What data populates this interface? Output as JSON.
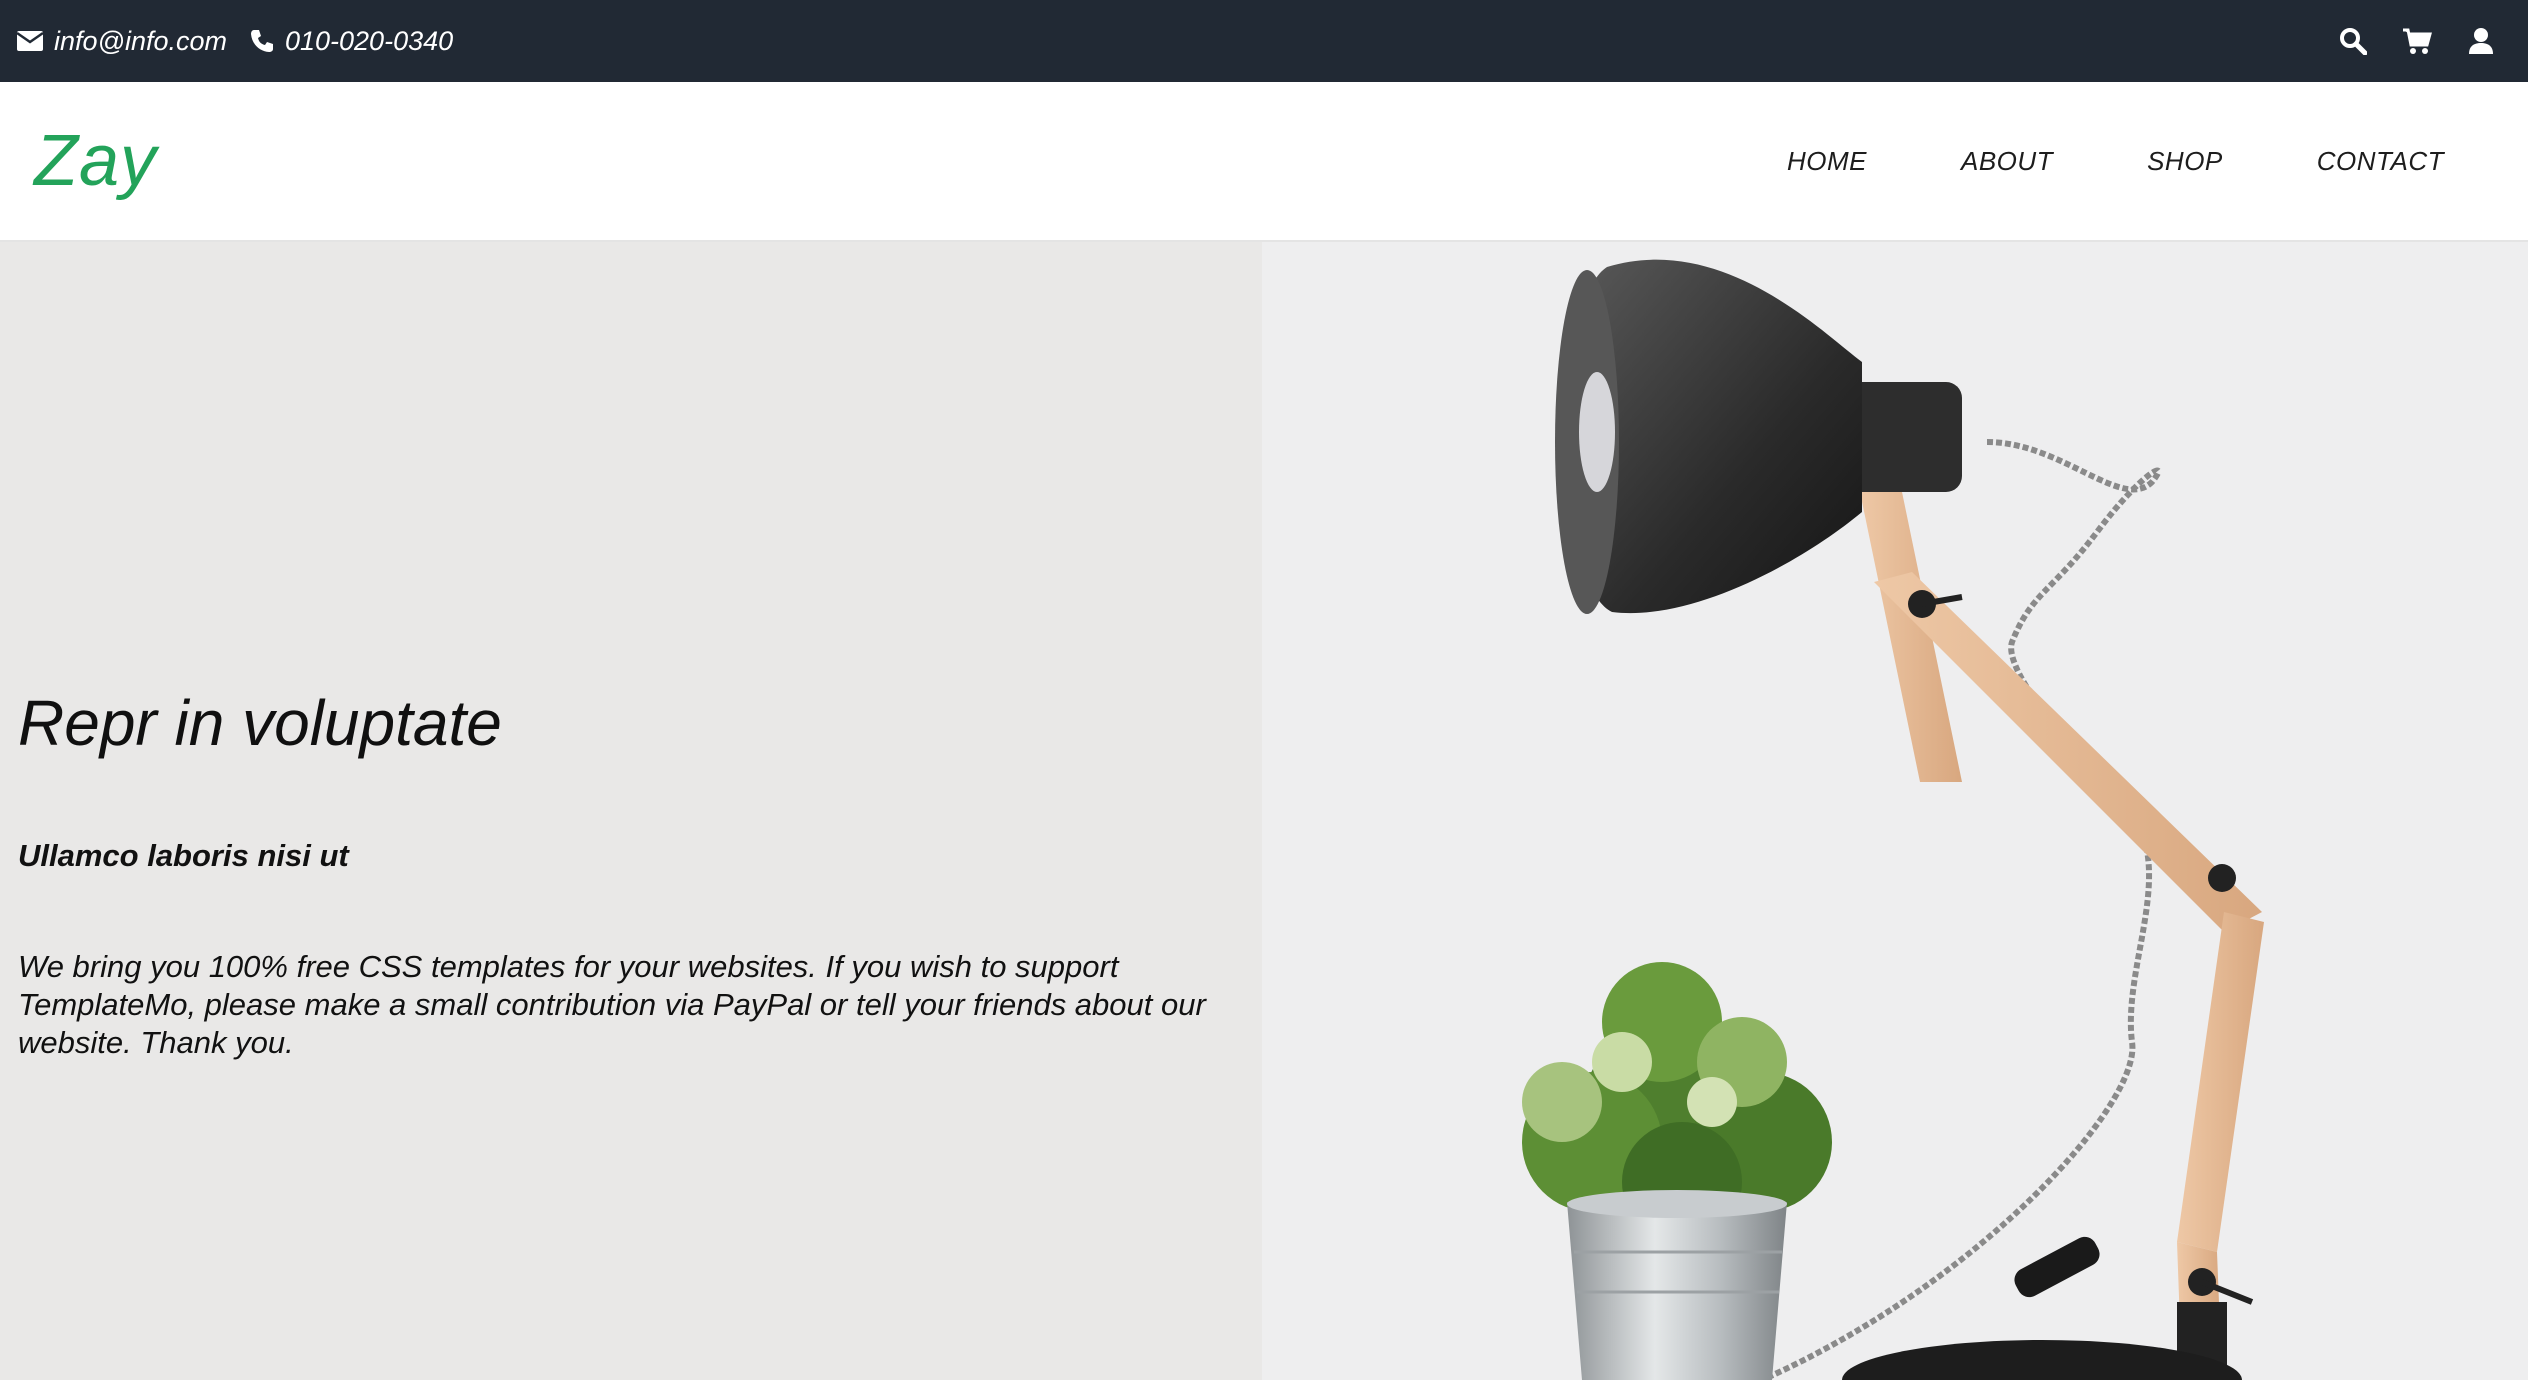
{
  "topbar": {
    "email": "info@info.com",
    "phone": "010-020-0340",
    "icons": [
      "envelope-icon",
      "phone-icon",
      "search-icon",
      "cart-icon",
      "user-icon"
    ]
  },
  "navbar": {
    "logo": "Zay",
    "links": [
      "HOME",
      "ABOUT",
      "SHOP",
      "CONTACT"
    ]
  },
  "hero": {
    "title": "Repr in voluptate",
    "subtitle": "Ullamco laboris nisi ut",
    "text": "We bring you 100% free CSS templates for your websites. If you wish to support TemplateMo, please make a small contribution via PayPal or tell your friends about our website. Thank you."
  },
  "colors": {
    "topbar_bg": "#212934",
    "brand_green": "#23a35a",
    "hero_bg": "#e9e8e7"
  }
}
